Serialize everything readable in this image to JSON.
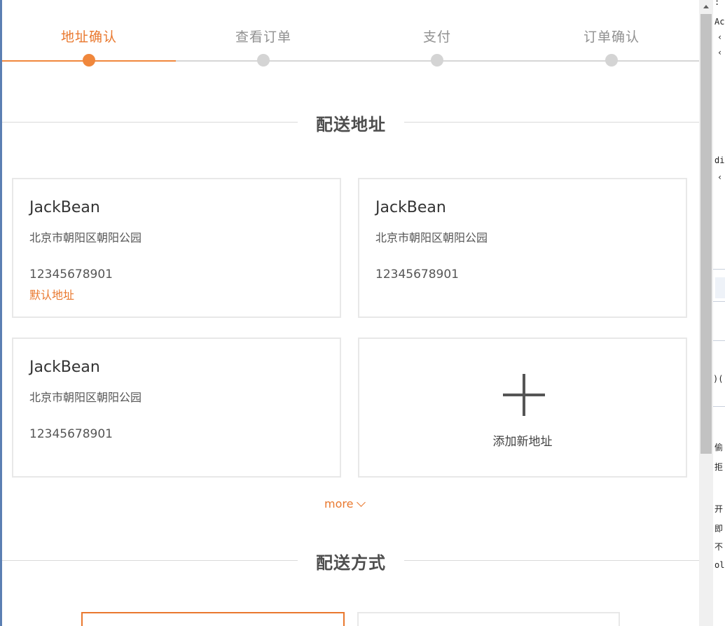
{
  "steps": [
    {
      "label": "地址确认",
      "active": true
    },
    {
      "label": "查看订单",
      "active": false
    },
    {
      "label": "支付",
      "active": false
    },
    {
      "label": "订单确认",
      "active": false
    }
  ],
  "address_section": {
    "title": "配送地址"
  },
  "addresses": [
    {
      "name": "JackBean",
      "address": "北京市朝阳区朝阳公园",
      "phone": "12345678901",
      "default_label": "默认地址"
    },
    {
      "name": "JackBean",
      "address": "北京市朝阳区朝阳公园",
      "phone": "12345678901"
    },
    {
      "name": "JackBean",
      "address": "北京市朝阳区朝阳公园",
      "phone": "12345678901"
    }
  ],
  "add_address": {
    "label": "添加新地址",
    "icon": "plus-icon"
  },
  "more": {
    "label": "more",
    "icon": "chevron-down-icon"
  },
  "shipping_section": {
    "title": "配送方式"
  },
  "background_app": {
    "fragments": [
      ":",
      "Ac",
      "‹",
      "‹",
      "di",
      "‹",
      ")(",
      "偷",
      "拒",
      "开",
      "即",
      "不",
      "ol"
    ]
  },
  "colors": {
    "accent": "#e9782e",
    "inactive": "#d4d4d4",
    "title": "#4d4d4d",
    "border": "#e8e8e8"
  }
}
